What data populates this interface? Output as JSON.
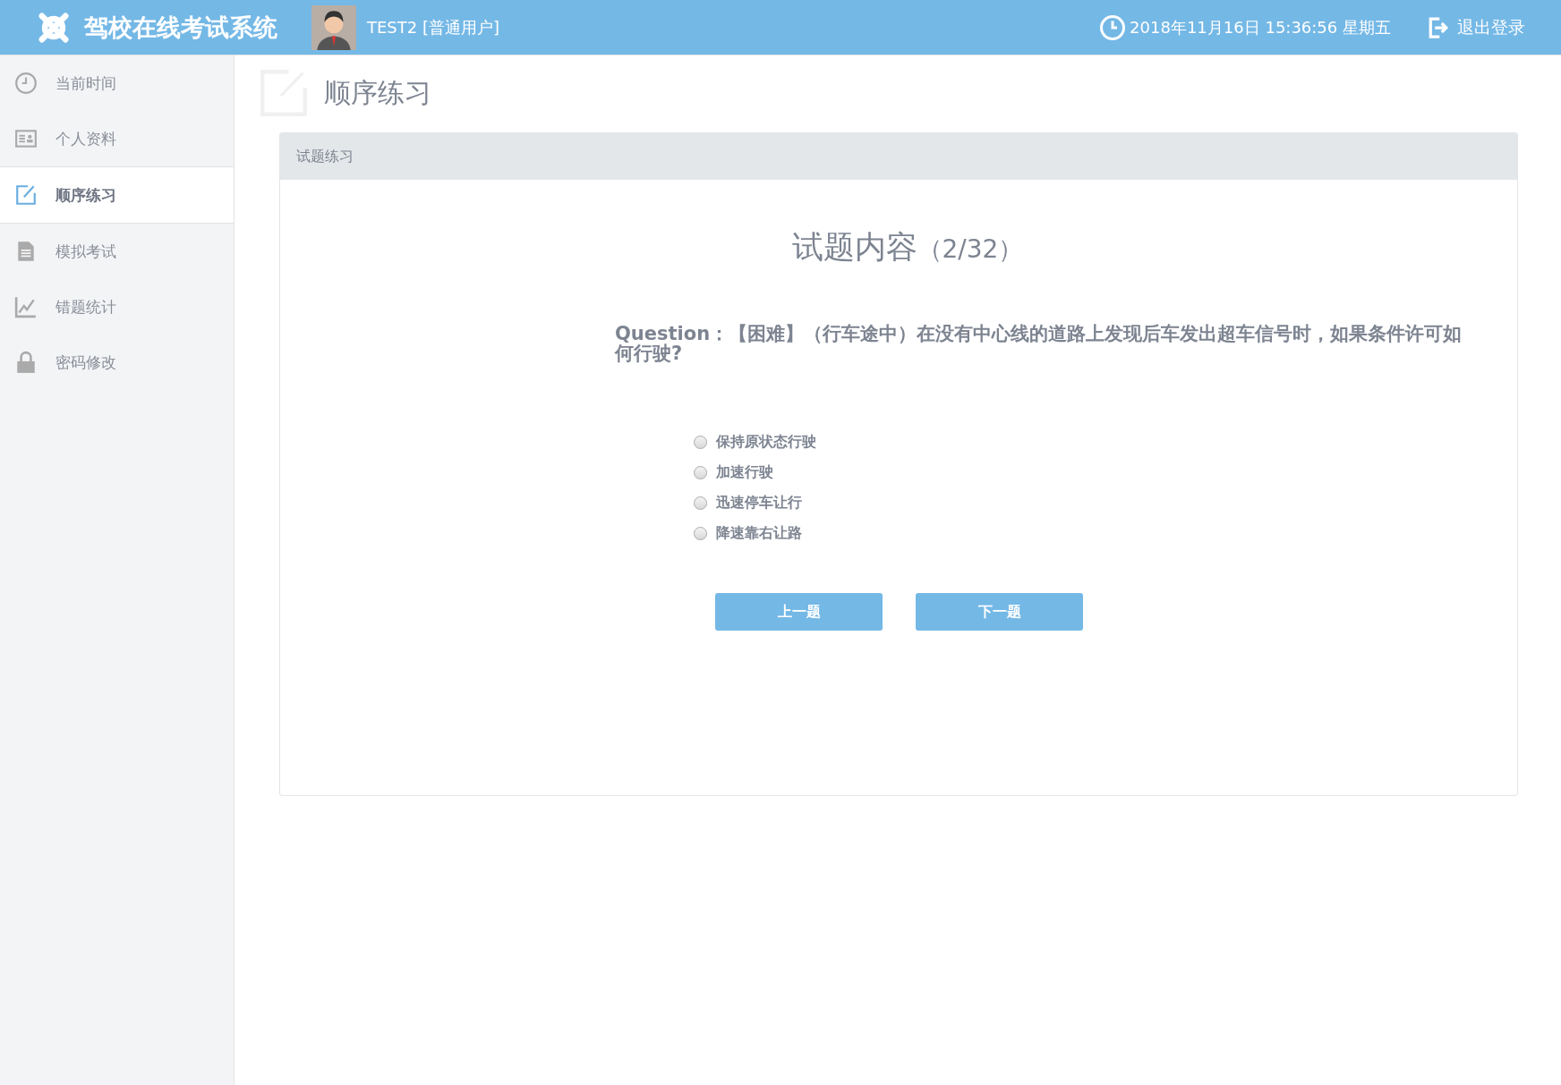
{
  "header": {
    "app_title": "驾校在线考试系统",
    "user": "TEST2 [普通用户]",
    "datetime": "2018年11月16日 15:36:56 星期五",
    "logout": "退出登录"
  },
  "sidebar": {
    "items": [
      {
        "label": "当前时间",
        "selected": false
      },
      {
        "label": "个人资料",
        "selected": false
      },
      {
        "label": "顺序练习",
        "selected": true
      },
      {
        "label": "模拟考试",
        "selected": false
      },
      {
        "label": "错题统计",
        "selected": false
      },
      {
        "label": "密码修改",
        "selected": false
      }
    ]
  },
  "page_title": "顺序练习",
  "panel": {
    "heading": "试题练习",
    "title": "试题内容",
    "counter": "（2/32）",
    "question": "Question：【困难】（行车途中）在没有中心线的道路上发现后车发出超车信号时，如果条件许可如何行驶?",
    "options": [
      {
        "label": "保持原状态行驶",
        "selected": false
      },
      {
        "label": "加速行驶",
        "selected": false
      },
      {
        "label": "迅速停车让行",
        "selected": false
      },
      {
        "label": "降速靠右让路",
        "selected": false
      }
    ],
    "buttons": [
      "上一题",
      "下一题"
    ]
  }
}
